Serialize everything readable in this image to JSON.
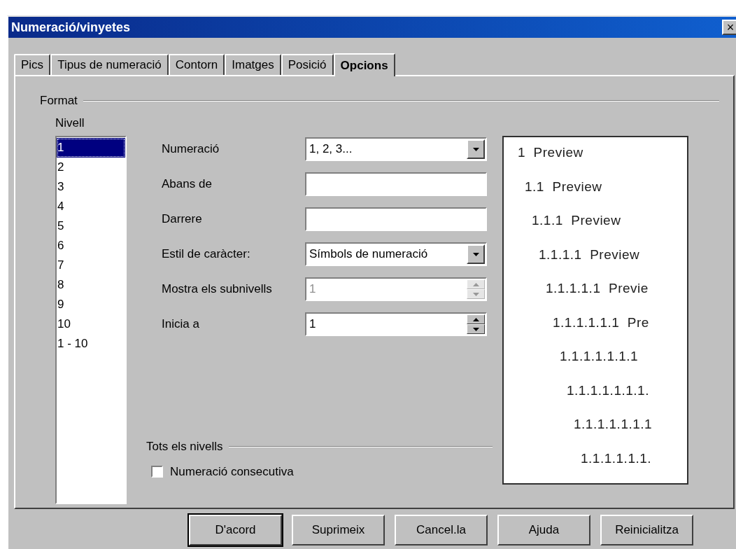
{
  "window": {
    "title": "Numeració/vinyetes",
    "close": "×"
  },
  "tabs": [
    {
      "label": "Pics",
      "selected": false
    },
    {
      "label": "Tipus de numeració",
      "selected": false
    },
    {
      "label": "Contorn",
      "selected": false
    },
    {
      "label": "Imatges",
      "selected": false
    },
    {
      "label": "Posició",
      "selected": false
    },
    {
      "label": "Opcions",
      "selected": true
    }
  ],
  "format": {
    "title": "Format",
    "level_label": "Nivell",
    "levels": [
      {
        "label": "1",
        "selected": true
      },
      {
        "label": "2",
        "selected": false
      },
      {
        "label": "3",
        "selected": false
      },
      {
        "label": "4",
        "selected": false
      },
      {
        "label": "5",
        "selected": false
      },
      {
        "label": "6",
        "selected": false
      },
      {
        "label": "7",
        "selected": false
      },
      {
        "label": "8",
        "selected": false
      },
      {
        "label": "9",
        "selected": false
      },
      {
        "label": "10",
        "selected": false
      },
      {
        "label": "1 - 10",
        "selected": false
      }
    ],
    "fields": [
      {
        "kind": "dropdown",
        "label": "Numeració",
        "value": "1, 2, 3...",
        "disabled": false
      },
      {
        "kind": "text",
        "label": "Abans de",
        "disabled": false
      },
      {
        "kind": "text",
        "label": "Darrere",
        "disabled": false
      },
      {
        "kind": "dropdown",
        "label": "Estil de caràcter:",
        "value": "Símbols de numeració",
        "disabled": false
      },
      {
        "kind": "spinner",
        "label": "Mostra els subnivells",
        "value": "1",
        "disabled": true
      },
      {
        "kind": "spinner",
        "label": "Inicia a",
        "value": "1",
        "disabled": false
      }
    ],
    "preview": [
      "1  Preview",
      "1.1  Preview",
      "1.1.1  Preview",
      "1.1.1.1  Preview",
      "1.1.1.1.1  Previe",
      "1.1.1.1.1.1  Pre",
      "1.1.1.1.1.1.1",
      "1.1.1.1.1.1.1.",
      "1.1.1.1.1.1.1",
      "1.1.1.1.1.1."
    ]
  },
  "all_levels": {
    "title": "Tots els nivells",
    "checkbox": {
      "label": "Numeració consecutiva",
      "checked": false
    }
  },
  "buttons": [
    {
      "label": "D'acord",
      "default": true
    },
    {
      "label": "Suprimeix",
      "default": false
    },
    {
      "label": "Cancel.la",
      "default": false
    },
    {
      "label": "Ajuda",
      "default": false
    },
    {
      "label": "Reinicialitza",
      "default": false
    }
  ]
}
